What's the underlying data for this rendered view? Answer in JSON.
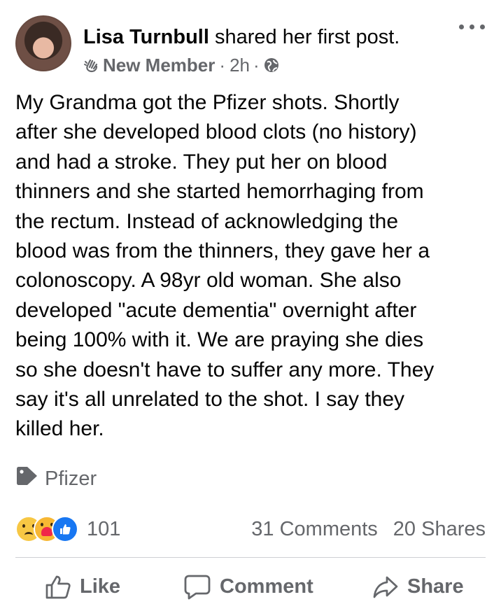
{
  "post": {
    "author": "Lisa Turnbull",
    "action": "shared her first post.",
    "role": "New Member",
    "time": "2h",
    "body_lines": [
      "My Grandma got the Pfizer shots.  Shortly",
      "after she developed blood clots (no history)",
      "and had a stroke.  They put her on blood",
      "thinners and she started hemorrhaging from",
      "the rectum.  Instead of acknowledging the",
      "blood was from the thinners, they gave her a",
      "colonoscopy.  A 98yr old woman.  She also",
      "developed \"acute dementia\" overnight after",
      "being 100% with it.  We are praying she dies",
      "so she doesn't have to suffer any more.  They",
      "say it's all unrelated to the shot.  I say they",
      "killed her."
    ],
    "tag": "Pfizer",
    "reactions_count": "101",
    "comments": "31 Comments",
    "shares": "20 Shares"
  },
  "actions": {
    "like": "Like",
    "comment": "Comment",
    "share": "Share"
  },
  "colors": {
    "text": "#050505",
    "muted": "#65676b",
    "divider": "#ced0d4",
    "like_blue": "#1877f2"
  },
  "icons": {
    "more": "more-horizontal-icon",
    "new_member": "wave-hand-icon",
    "privacy": "globe-icon",
    "tag": "tag-icon",
    "like": "thumbs-up-icon",
    "comment": "comment-bubble-icon",
    "share": "share-arrow-icon"
  }
}
